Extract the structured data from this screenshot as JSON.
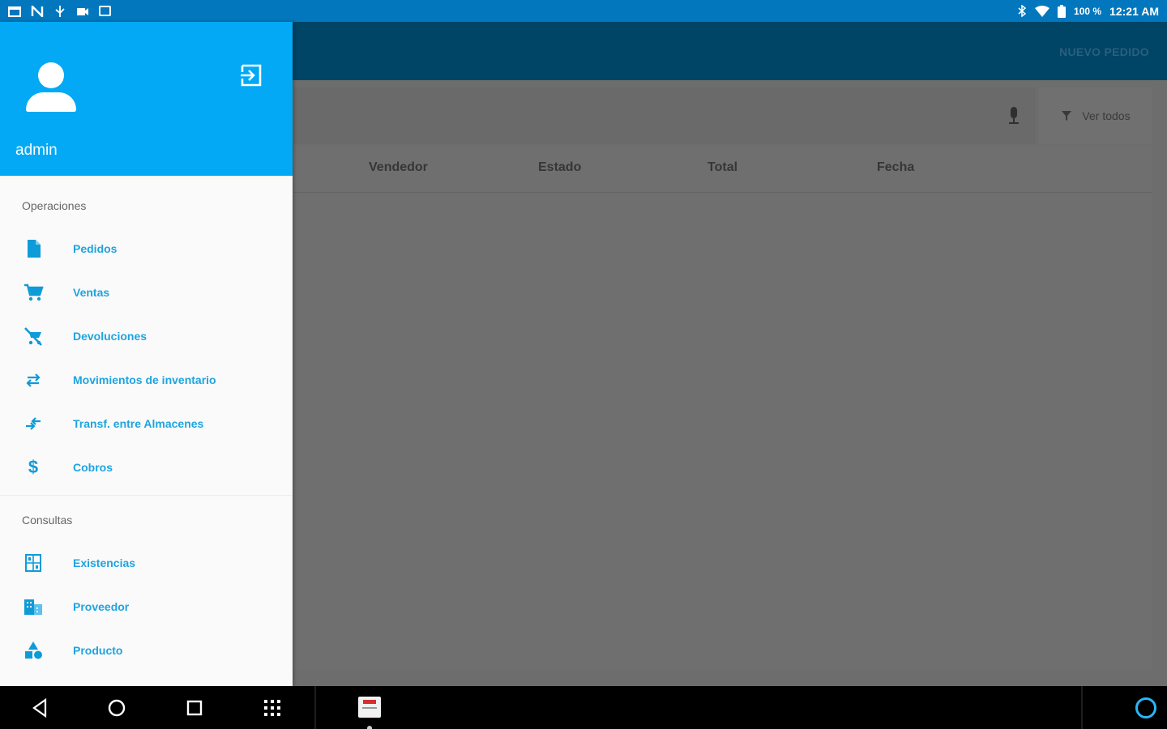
{
  "status_bar": {
    "battery": "100 %",
    "time": "12:21 AM",
    "left_icons": [
      "calendar-icon",
      "n-icon",
      "usb-icon",
      "video-icon",
      "box-icon"
    ],
    "right_icons": [
      "bluetooth-icon",
      "wifi-icon",
      "battery-icon"
    ]
  },
  "app_bar": {
    "action_label": "NUEVO PEDIDO"
  },
  "toolbar": {
    "filter_label": "Ver todos",
    "icons": [
      "mic-icon",
      "filter-icon"
    ]
  },
  "table": {
    "columns": [
      "Vendedor",
      "Estado",
      "Total",
      "Fecha"
    ]
  },
  "drawer": {
    "username": "admin",
    "sections": [
      {
        "title": "Operaciones",
        "items": [
          {
            "label": "Pedidos",
            "icon": "document-icon"
          },
          {
            "label": "Ventas",
            "icon": "cart-icon"
          },
          {
            "label": "Devoluciones",
            "icon": "cart-off-icon"
          },
          {
            "label": "Movimientos de inventario",
            "icon": "swap-icon"
          },
          {
            "label": "Transf. entre Almacenes",
            "icon": "transfer-icon"
          },
          {
            "label": "Cobros",
            "icon": "dollar-icon"
          }
        ]
      },
      {
        "title": "Consultas",
        "items": [
          {
            "label": "Existencias",
            "icon": "inventory-icon"
          },
          {
            "label": "Proveedor",
            "icon": "building-icon"
          },
          {
            "label": "Producto",
            "icon": "shapes-icon"
          }
        ]
      }
    ]
  },
  "colors": {
    "status_bar": "#0277bd",
    "drawer_header": "#03a9f4",
    "accent": "#1ea4e0",
    "app_bar_dimmed": "#004466",
    "scrim": "#6d6d6d"
  },
  "nav_bar": {
    "icons": [
      "back-icon",
      "home-icon",
      "recents-icon",
      "apps-grid-icon",
      "app-thumbnail-icon",
      "assistant-icon"
    ]
  }
}
